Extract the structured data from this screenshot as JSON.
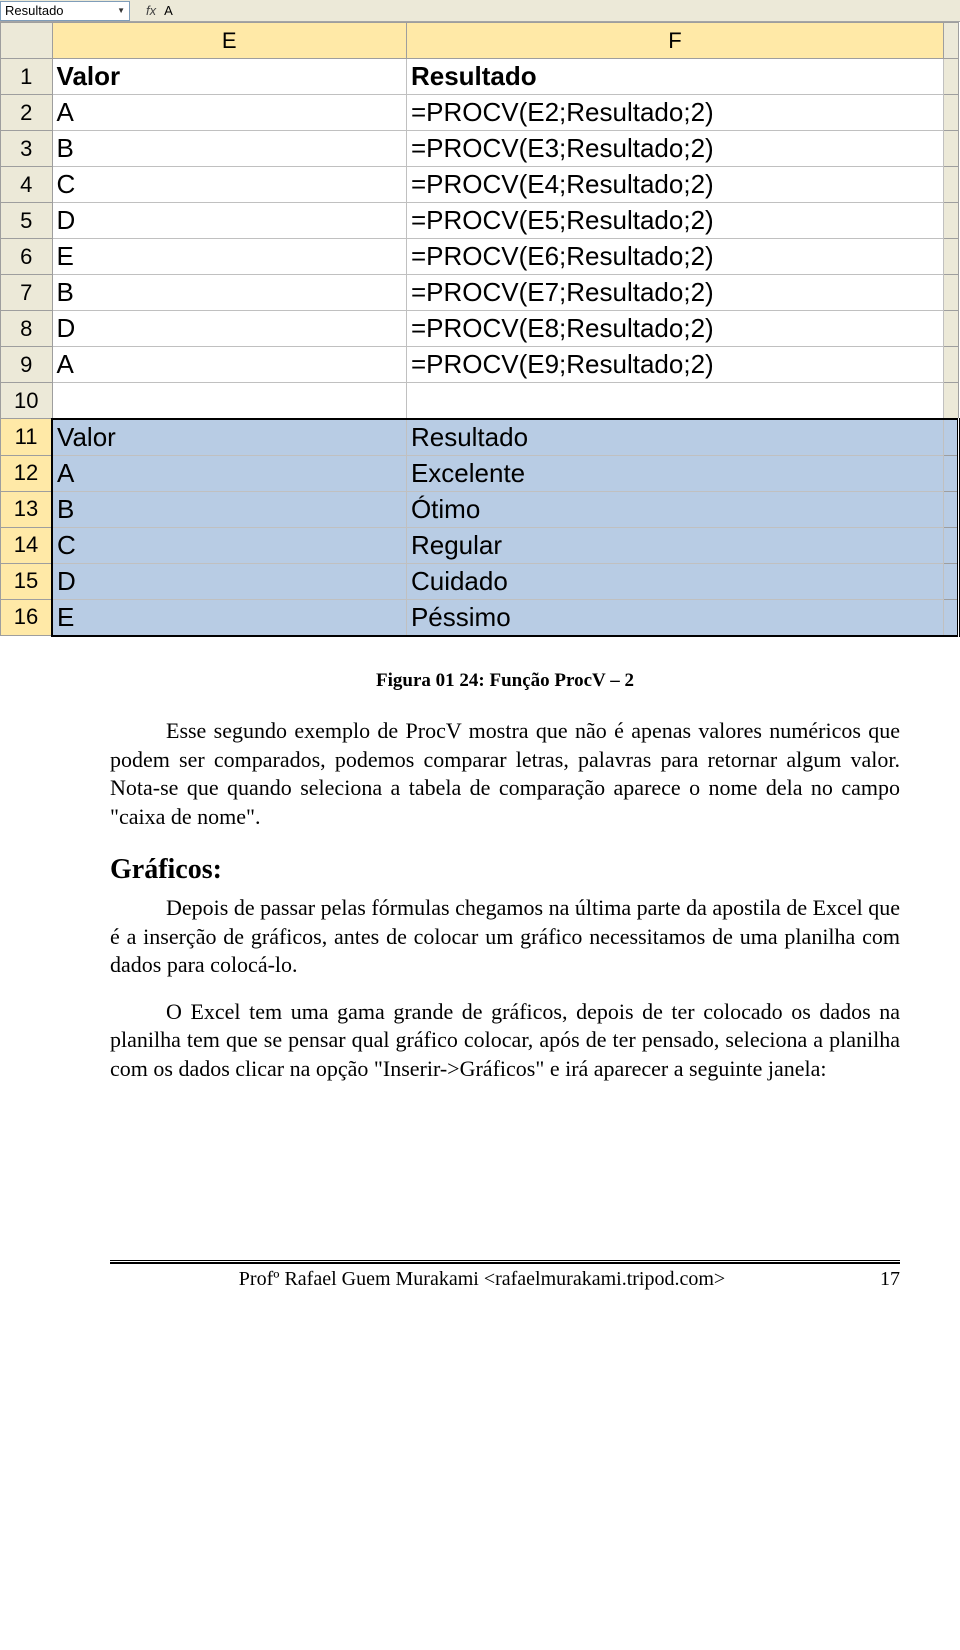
{
  "namebox": {
    "value": "Resultado"
  },
  "formulabar": {
    "fx_label": "fx",
    "value": "A"
  },
  "columns": {
    "E": "E",
    "F": "F"
  },
  "rows": [
    {
      "n": "1",
      "e": "Valor",
      "f": "Resultado",
      "bold": true
    },
    {
      "n": "2",
      "e": "A",
      "f": "=PROCV(E2;Resultado;2)"
    },
    {
      "n": "3",
      "e": "B",
      "f": "=PROCV(E3;Resultado;2)"
    },
    {
      "n": "4",
      "e": "C",
      "f": "=PROCV(E4;Resultado;2)"
    },
    {
      "n": "5",
      "e": "D",
      "f": "=PROCV(E5;Resultado;2)"
    },
    {
      "n": "6",
      "e": "E",
      "f": "=PROCV(E6;Resultado;2)"
    },
    {
      "n": "7",
      "e": "B",
      "f": "=PROCV(E7;Resultado;2)"
    },
    {
      "n": "8",
      "e": "D",
      "f": "=PROCV(E8;Resultado;2)"
    },
    {
      "n": "9",
      "e": "A",
      "f": "=PROCV(E9;Resultado;2)"
    },
    {
      "n": "10",
      "e": "",
      "f": ""
    },
    {
      "n": "11",
      "e": "Valor",
      "f": "Resultado",
      "sel": true,
      "top": true
    },
    {
      "n": "12",
      "e": "A",
      "f": "Excelente",
      "sel": true
    },
    {
      "n": "13",
      "e": "B",
      "f": "Ótimo",
      "sel": true
    },
    {
      "n": "14",
      "e": "C",
      "f": "Regular",
      "sel": true
    },
    {
      "n": "15",
      "e": "D",
      "f": "Cuidado",
      "sel": true
    },
    {
      "n": "16",
      "e": "E",
      "f": "Péssimo",
      "sel": true,
      "bot": true
    }
  ],
  "caption": "Figura 01 24: Função ProcV – 2",
  "para1": "Esse segundo exemplo de ProcV mostra que não é apenas valores numéricos que podem ser comparados, podemos comparar letras, palavras para retornar algum valor. Nota-se que quando seleciona a tabela de comparação aparece o nome dela no campo \"caixa de nome\".",
  "heading": "Gráficos:",
  "para2": "Depois de passar pelas fórmulas chegamos na última parte da apostila de Excel que é a inserção de gráficos, antes de colocar um gráfico necessitamos de uma planilha com dados para colocá-lo.",
  "para3": "O Excel tem uma gama grande de gráficos, depois de ter colocado os dados na planilha tem que se pensar qual gráfico colocar, após de ter pensado, seleciona a planilha com os dados clicar na opção \"Inserir->Gráficos\" e irá aparecer a seguinte janela:",
  "footer": {
    "author": "Profº Rafael Guem Murakami <rafaelmurakami.tripod.com>",
    "page": "17"
  }
}
